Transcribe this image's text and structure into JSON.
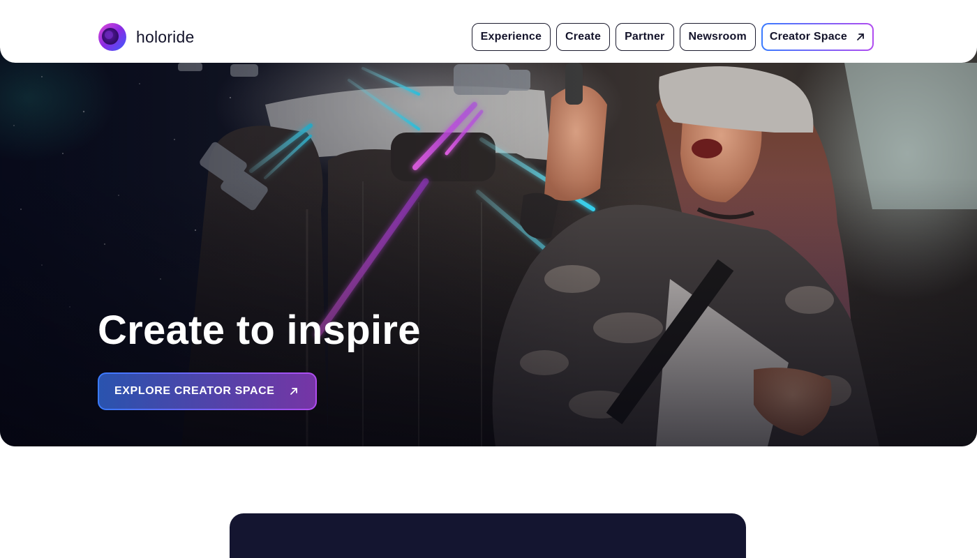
{
  "brand": {
    "name": "holoride",
    "logo_icon": "holoride-ring-logo"
  },
  "nav": {
    "items": [
      {
        "label": "Experience"
      },
      {
        "label": "Create"
      },
      {
        "label": "Partner"
      },
      {
        "label": "Newsroom"
      }
    ],
    "creator_space": {
      "label": "Creator Space",
      "icon": "arrow-up-right-icon"
    }
  },
  "hero": {
    "title": "Create to inspire",
    "cta_label": "EXPLORE CREATOR SPACE",
    "cta_icon": "arrow-up-right-icon",
    "image": "woman-wearing-vr-headset-in-car-backseat"
  },
  "colors": {
    "accent_blue": "#3a7bff",
    "accent_purple": "#b04cf0",
    "text_dark": "#13132a",
    "card_navy": "#141530"
  }
}
